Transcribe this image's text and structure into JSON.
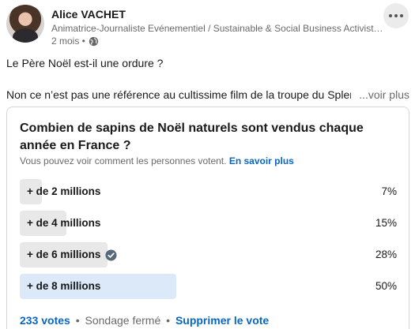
{
  "author": {
    "name": "Alice VACHET",
    "headline": "Animatrice-Journaliste Evénementiel / Sustainable & Social Business Activist ...",
    "time": "2 mois •"
  },
  "post": {
    "line1": "Le Père Noël est-il une ordure ?",
    "line2": "Non ce n’est pas une référence au cultissime film de la troupe du Splendid",
    "see_more": "...voir plus"
  },
  "poll": {
    "question": "Combien de sapins de Noël naturels sont vendus chaque année en France ?",
    "notice": "Vous pouvez voir comment les personnes votent.",
    "learn_more": "En savoir plus",
    "options": [
      {
        "label": "+ de 2 millions",
        "percent_text": "7%",
        "share": 0.07,
        "voted": false
      },
      {
        "label": "+ de 4 millions",
        "percent_text": "15%",
        "share": 0.15,
        "voted": false
      },
      {
        "label": "+ de 6 millions",
        "percent_text": "28%",
        "share": 0.28,
        "voted": true
      },
      {
        "label": "+ de 8 millions",
        "percent_text": "50%",
        "share": 0.5,
        "voted": false
      }
    ],
    "votes": "233 votes",
    "status": "Sondage fermé",
    "delete_vote": "Supprimer le vote",
    "separator": "•"
  },
  "icons": {
    "more": "more-horizontal-icon",
    "visibility": "globe-icon",
    "voted": "check-circle-icon"
  },
  "colors": {
    "link": "#0a66c2",
    "bar": "#e8e8e8",
    "bar_leading": "#dce9f8"
  }
}
